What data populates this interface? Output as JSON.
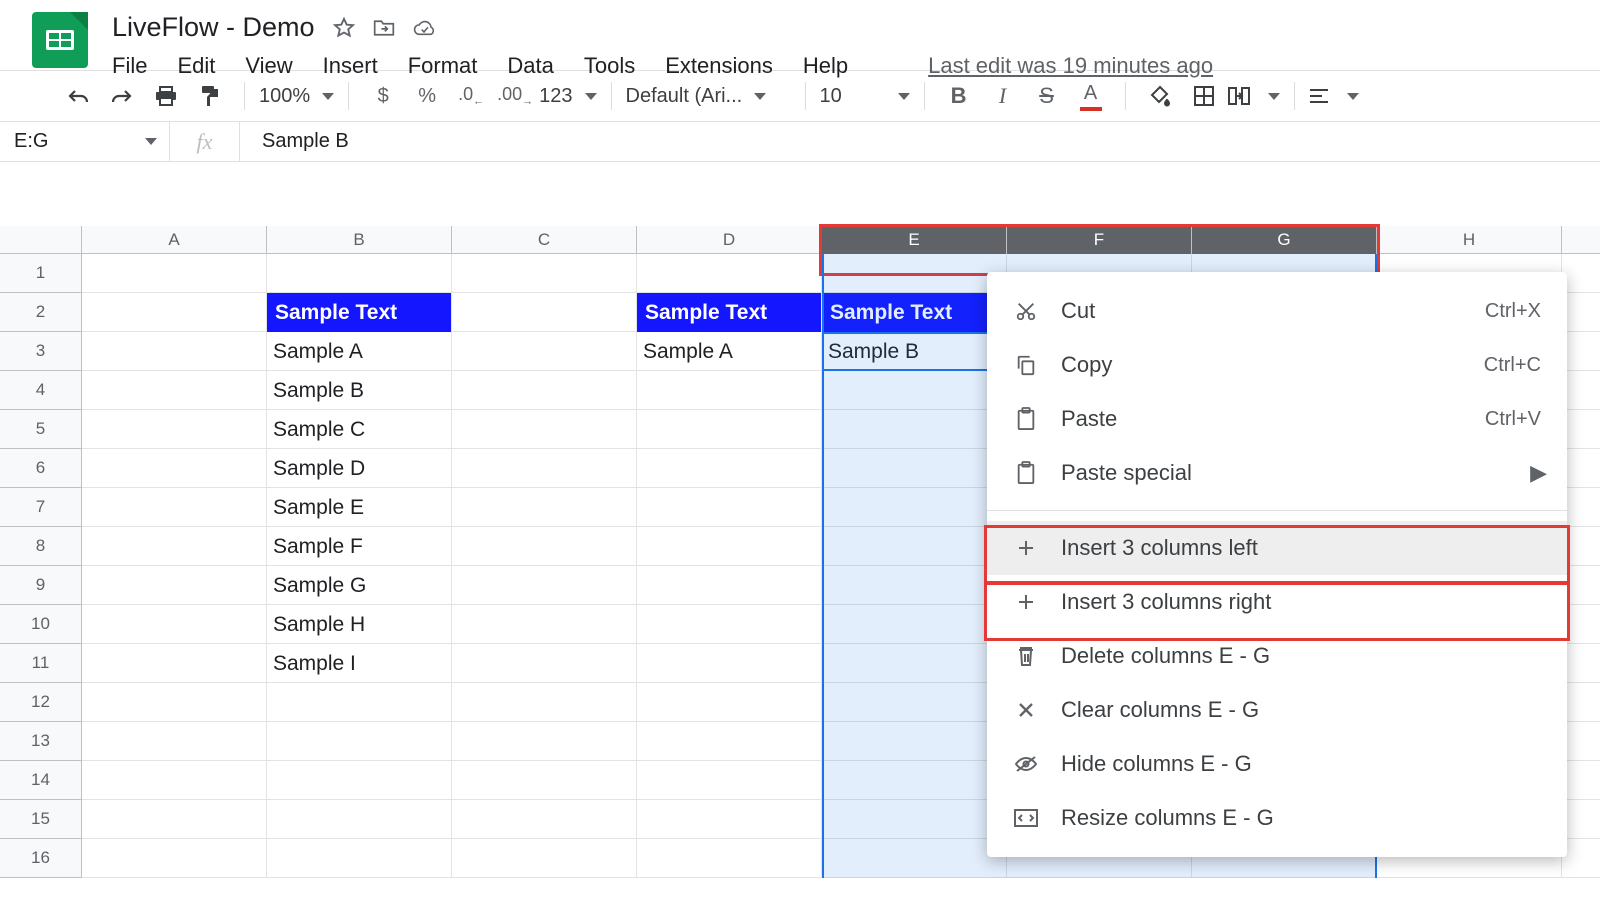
{
  "doc": {
    "title": "LiveFlow - Demo"
  },
  "menubar": {
    "items": [
      "File",
      "Edit",
      "View",
      "Insert",
      "Format",
      "Data",
      "Tools",
      "Extensions",
      "Help"
    ],
    "last_edit": "Last edit was 19 minutes ago"
  },
  "toolbar": {
    "zoom": "100%",
    "font": "Default (Ari...",
    "font_size": "10",
    "num_format": "123"
  },
  "formula_bar": {
    "name_box": "E:G",
    "value": "Sample B"
  },
  "columns": {
    "labels": [
      "A",
      "B",
      "C",
      "D",
      "E",
      "F",
      "G",
      "H"
    ],
    "widths": [
      185,
      185,
      185,
      185,
      185,
      185,
      185,
      185
    ],
    "selected": [
      "E",
      "F",
      "G"
    ]
  },
  "rows": {
    "count": 16
  },
  "cells": {
    "B2": {
      "text": "Sample Text",
      "style": "header"
    },
    "B3": {
      "text": "Sample A"
    },
    "B4": {
      "text": "Sample B"
    },
    "B5": {
      "text": "Sample C"
    },
    "B6": {
      "text": "Sample D"
    },
    "B7": {
      "text": "Sample E"
    },
    "B8": {
      "text": "Sample F"
    },
    "B9": {
      "text": "Sample G"
    },
    "B10": {
      "text": "Sample H"
    },
    "B11": {
      "text": "Sample I"
    },
    "D2": {
      "text": "Sample Text",
      "style": "header"
    },
    "D3": {
      "text": "Sample A"
    },
    "E2": {
      "text": "Sample Text",
      "style": "header"
    },
    "E3": {
      "text": "Sample B"
    }
  },
  "context_menu": {
    "items": [
      {
        "icon": "cut",
        "label": "Cut",
        "shortcut": "Ctrl+X"
      },
      {
        "icon": "copy",
        "label": "Copy",
        "shortcut": "Ctrl+C"
      },
      {
        "icon": "paste",
        "label": "Paste",
        "shortcut": "Ctrl+V"
      },
      {
        "icon": "paste",
        "label": "Paste special",
        "submenu": true
      },
      {
        "sep": true
      },
      {
        "icon": "plus",
        "label": "Insert 3 columns left",
        "highlight": true
      },
      {
        "icon": "plus",
        "label": "Insert 3 columns right"
      },
      {
        "icon": "trash",
        "label": "Delete columns E - G"
      },
      {
        "icon": "close",
        "label": "Clear columns E - G"
      },
      {
        "icon": "hide",
        "label": "Hide columns E - G"
      },
      {
        "icon": "resize",
        "label": "Resize columns E - G"
      }
    ]
  }
}
